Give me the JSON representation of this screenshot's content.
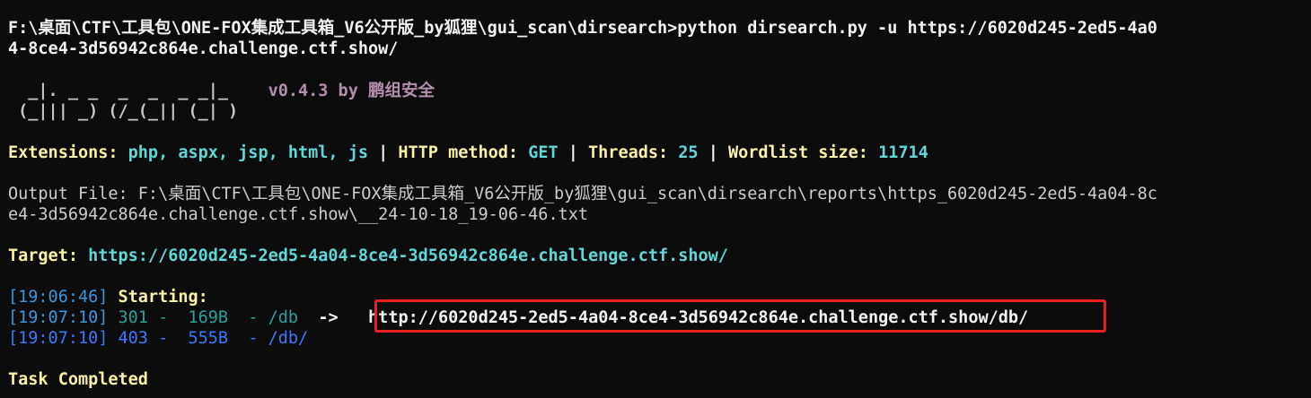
{
  "command": {
    "line1": "F:\\桌面\\CTF\\工具包\\ONE-FOX集成工具箱_V6公开版_by狐狸\\gui_scan\\dirsearch>python dirsearch.py -u https://6020d245-2ed5-4a0",
    "line2": "4-8ce4-3d56942c864e.challenge.ctf.show/"
  },
  "banner": {
    "art1": "  _|. _ _  _  _  _ _|_    ",
    "art2": " (_||| _) (/_(_|| (_| )   ",
    "version": "v0.4.3 by 鹏组安全"
  },
  "config": {
    "ext_label": "Extensions: ",
    "ext_value": "php, aspx, jsp, html, js",
    "sep1": " | ",
    "method_label": "HTTP method: ",
    "method_value": "GET",
    "sep2": " | ",
    "threads_label": "Threads: ",
    "threads_value": "25",
    "sep3": " | ",
    "wordlist_label": "Wordlist size: ",
    "wordlist_value": "11714"
  },
  "output": {
    "line1": "Output File: F:\\桌面\\CTF\\工具包\\ONE-FOX集成工具箱_V6公开版_by狐狸\\gui_scan\\dirsearch\\reports\\https_6020d245-2ed5-4a04-8c",
    "line2": "e4-3d56942c864e.challenge.ctf.show\\__24-10-18_19-06-46.txt"
  },
  "target": {
    "label": "Target: ",
    "url": "https://6020d245-2ed5-4a04-8ce4-3d56942c864e.challenge.ctf.show/"
  },
  "scan": {
    "start_time": "[19:06:46]",
    "start_label": " Starting: ",
    "results": [
      {
        "time": "[19:07:10]",
        "status": "301",
        "size": "169B",
        "path": "/db",
        "arrow": "  -> ",
        "redirect": "http://6020d245-2ed5-4a04-8ce4-3d56942c864e.challenge.ctf.show/db/"
      },
      {
        "time": "[19:07:10]",
        "status": "403",
        "size": "555B",
        "path": "/db/",
        "arrow": "",
        "redirect": ""
      }
    ]
  },
  "footer": {
    "completed": "Task Completed"
  },
  "colors": {
    "background": "#0c0c0c",
    "highlight_box": "#e8201e"
  }
}
